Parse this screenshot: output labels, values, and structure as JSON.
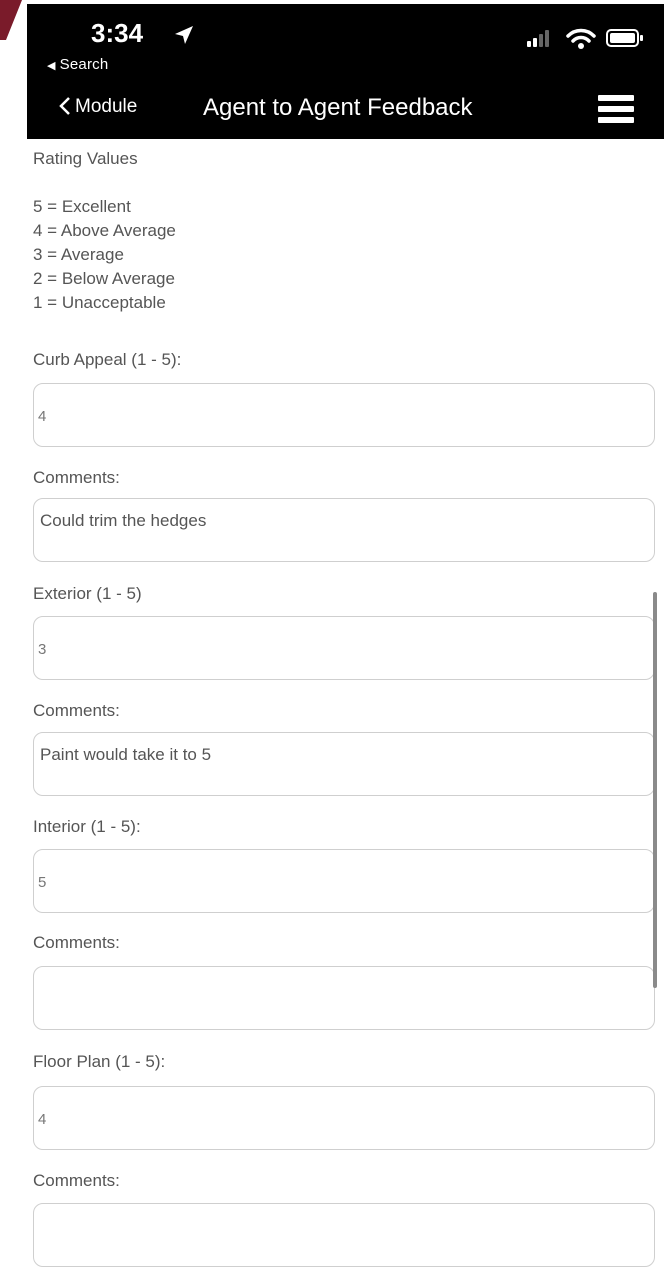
{
  "colors": {
    "accent": "#7a1b2a",
    "header_bg": "#000000"
  },
  "status_bar": {
    "time": "3:34",
    "back_app_label": "Search",
    "icons": [
      "location-arrow-icon",
      "cellular-signal-icon",
      "wifi-icon",
      "battery-icon"
    ]
  },
  "nav": {
    "back_label": "Module",
    "title": "Agent to Agent Feedback",
    "menu_icon": "hamburger-menu-icon"
  },
  "rating": {
    "title": "Rating Values",
    "values": [
      "5 = Excellent",
      "4 = Above Average",
      "3 = Average",
      "2 = Below Average",
      "1 = Unacceptable"
    ]
  },
  "fields": [
    {
      "label": "Curb Appeal (1 - 5):",
      "value": "4"
    },
    {
      "label": "Comments:",
      "value": "Could trim the hedges"
    },
    {
      "label": "Exterior (1 - 5)",
      "value": "3"
    },
    {
      "label": "Comments:",
      "value": "Paint would take it to 5"
    },
    {
      "label": "Interior (1 - 5):",
      "value": "5"
    },
    {
      "label": "Comments:",
      "value": ""
    },
    {
      "label": "Floor Plan (1 - 5):",
      "value": "4"
    },
    {
      "label": "Comments:",
      "value": ""
    }
  ]
}
